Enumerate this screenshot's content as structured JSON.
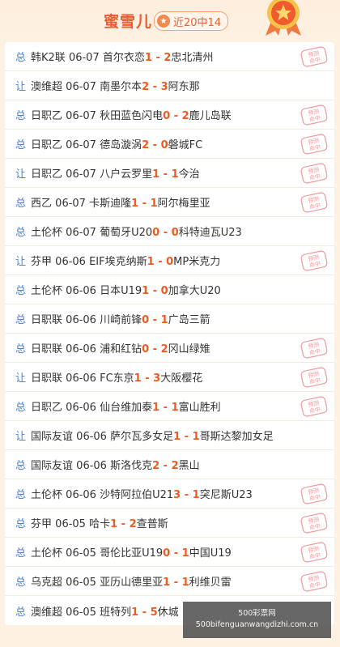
{
  "header": {
    "title": "蜜雪儿",
    "badge_label": "近20中14",
    "badge_icon": "star-icon"
  },
  "stamp_label": "预测命中",
  "matches": [
    {
      "type": "总",
      "league": "韩K2联",
      "date": "06-07",
      "home": "首尔衣恋",
      "hs": "1",
      "as": "2",
      "away": "忠北清州",
      "hit": true
    },
    {
      "type": "让",
      "league": "澳维超",
      "date": "06-07",
      "home": "南墨尔本",
      "hs": "2",
      "as": "3",
      "away": "阿东那",
      "hit": false
    },
    {
      "type": "总",
      "league": "日职乙",
      "date": "06-07",
      "home": "秋田蓝色闪电",
      "hs": "0",
      "as": "2",
      "away": "鹿儿岛联",
      "hit": true
    },
    {
      "type": "总",
      "league": "日职乙",
      "date": "06-07",
      "home": "德岛漩涡",
      "hs": "2",
      "as": "0",
      "away": "磐城FC",
      "hit": true
    },
    {
      "type": "让",
      "league": "日职乙",
      "date": "06-07",
      "home": "八户云罗里",
      "hs": "1",
      "as": "1",
      "away": "今治",
      "hit": true
    },
    {
      "type": "总",
      "league": "西乙",
      "date": "06-07",
      "home": "卡斯迪隆",
      "hs": "1",
      "as": "1",
      "away": "阿尔梅里亚",
      "hit": true
    },
    {
      "type": "总",
      "league": "土伦杯",
      "date": "06-07",
      "home": "葡萄牙U20",
      "hs": "0",
      "as": "0",
      "away": "科特迪瓦U23",
      "hit": false
    },
    {
      "type": "让",
      "league": "芬甲",
      "date": "06-06",
      "home": "EIF埃克纳斯",
      "hs": "1",
      "as": "0",
      "away": "MP米克力",
      "hit": true
    },
    {
      "type": "总",
      "league": "土伦杯",
      "date": "06-06",
      "home": "日本U19",
      "hs": "1",
      "as": "0",
      "away": "加拿大U20",
      "hit": false
    },
    {
      "type": "总",
      "league": "日职联",
      "date": "06-06",
      "home": "川崎前锋",
      "hs": "0",
      "as": "1",
      "away": "广岛三箭",
      "hit": false
    },
    {
      "type": "总",
      "league": "日职联",
      "date": "06-06",
      "home": "浦和红钻",
      "hs": "0",
      "as": "2",
      "away": "冈山绿雉",
      "hit": true
    },
    {
      "type": "让",
      "league": "日职联",
      "date": "06-06",
      "home": "FC东京",
      "hs": "1",
      "as": "3",
      "away": "大阪樱花",
      "hit": true
    },
    {
      "type": "总",
      "league": "日职乙",
      "date": "06-06",
      "home": "仙台维加泰",
      "hs": "1",
      "as": "1",
      "away": "富山胜利",
      "hit": true
    },
    {
      "type": "让",
      "league": "国际友谊",
      "date": "06-06",
      "home": "萨尔瓦多女足",
      "hs": "1",
      "as": "1",
      "away": "哥斯达黎加女足",
      "hit": false
    },
    {
      "type": "总",
      "league": "国际友谊",
      "date": "06-06",
      "home": "斯洛伐克",
      "hs": "2",
      "as": "2",
      "away": "黑山",
      "hit": false
    },
    {
      "type": "总",
      "league": "土伦杯",
      "date": "06-06",
      "home": "沙特阿拉伯U21",
      "hs": "3",
      "as": "1",
      "away": "突尼斯U23",
      "hit": true
    },
    {
      "type": "总",
      "league": "芬甲",
      "date": "06-05",
      "home": "哈卡",
      "hs": "1",
      "as": "2",
      "away": "查普斯",
      "hit": true
    },
    {
      "type": "总",
      "league": "土伦杯",
      "date": "06-05",
      "home": "哥伦比亚U19",
      "hs": "0",
      "as": "1",
      "away": "中国U19",
      "hit": true
    },
    {
      "type": "总",
      "league": "乌克超",
      "date": "06-05",
      "home": "亚历山德里亚",
      "hs": "1",
      "as": "1",
      "away": "利维贝雷",
      "hit": true
    },
    {
      "type": "总",
      "league": "澳维超",
      "date": "06-05",
      "home": "班特列",
      "hs": "1",
      "as": "5",
      "away": "休城",
      "hit": false
    }
  ],
  "watermark": {
    "line1": "500彩票网",
    "line2": "500bifenguanwangdizhi.com.cn"
  }
}
